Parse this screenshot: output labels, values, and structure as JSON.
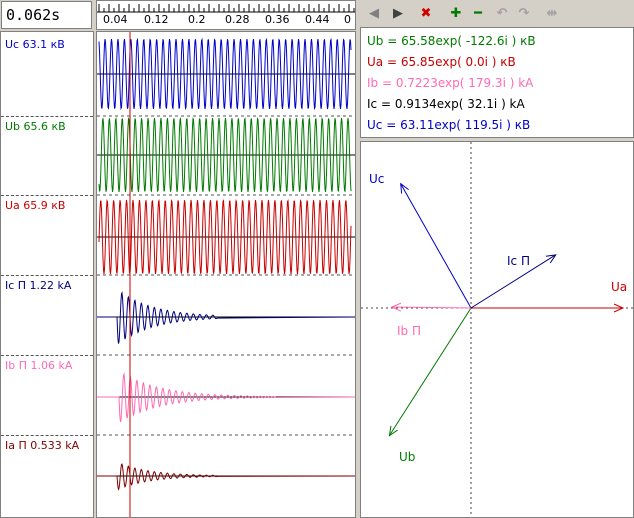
{
  "time_readout": "0.062s",
  "ruler": {
    "ticks": [
      "0.04",
      "0.12",
      "0.2",
      "0.28",
      "0.36",
      "0.44",
      "0"
    ]
  },
  "channels": [
    {
      "id": "uc",
      "label": "Uc  63.1 кВ",
      "color": "#0000c8"
    },
    {
      "id": "ub",
      "label": "Ub  65.6 кВ",
      "color": "#007a00"
    },
    {
      "id": "ua",
      "label": "Ua  65.9 кВ",
      "color": "#c80000"
    },
    {
      "id": "ic",
      "label": "Ic П 1.22 kA",
      "color": "#000080"
    },
    {
      "id": "ib",
      "label": "Ib П 1.06 kA",
      "color": "#ff69b4"
    },
    {
      "id": "ia",
      "label": "Ia П  0.533 kA",
      "color": "#800000"
    }
  ],
  "toolbar": {
    "buttons": [
      {
        "name": "prev-button",
        "icon": "◀",
        "color": "#808080"
      },
      {
        "name": "next-button",
        "icon": "▶",
        "color": "#404040"
      },
      {
        "name": "delete-button",
        "icon": "✖",
        "color": "#d00000"
      },
      {
        "name": "add-button",
        "icon": "✚",
        "color": "#007a00"
      },
      {
        "name": "remove-button",
        "icon": "━",
        "color": "#007a00"
      },
      {
        "name": "undo-button",
        "icon": "↶",
        "color": "#a0a0a0"
      },
      {
        "name": "redo-button",
        "icon": "↷",
        "color": "#a0a0a0"
      },
      {
        "name": "swap-button",
        "icon": "⇹",
        "color": "#a0a0a0"
      }
    ]
  },
  "phasors": [
    {
      "text": "Ub = 65.58exp( -122.6i ) кВ",
      "color": "#007a00"
    },
    {
      "text": "Ua = 65.85exp( 0.0i ) кВ",
      "color": "#c80000"
    },
    {
      "text": "Ib  = 0.7223exp( 179.3i ) kA",
      "color": "#ff69b4"
    },
    {
      "text": "Ic  = 0.9134exp( 32.1i ) kA",
      "color": "#000000"
    },
    {
      "text": "Uc = 63.11exp( 119.5i ) кВ",
      "color": "#0000c8"
    }
  ],
  "vectors": {
    "uc": {
      "label": "Uc",
      "color": "#0000c8",
      "magnitude": 63.11,
      "angle": 119.5
    },
    "ub": {
      "label": "Ub",
      "color": "#007a00",
      "magnitude": 65.58,
      "angle": -122.6
    },
    "ua": {
      "label": "Ua",
      "color": "#c80000",
      "magnitude": 65.85,
      "angle": 0.0
    },
    "ic": {
      "label": "Ic П",
      "color": "#000080",
      "magnitude": 0.9134,
      "angle": 32.1
    },
    "ib": {
      "label": "Ib П",
      "color": "#ff69b4",
      "magnitude": 0.7223,
      "angle": 179.3
    }
  },
  "cursor_time": 0.062
}
